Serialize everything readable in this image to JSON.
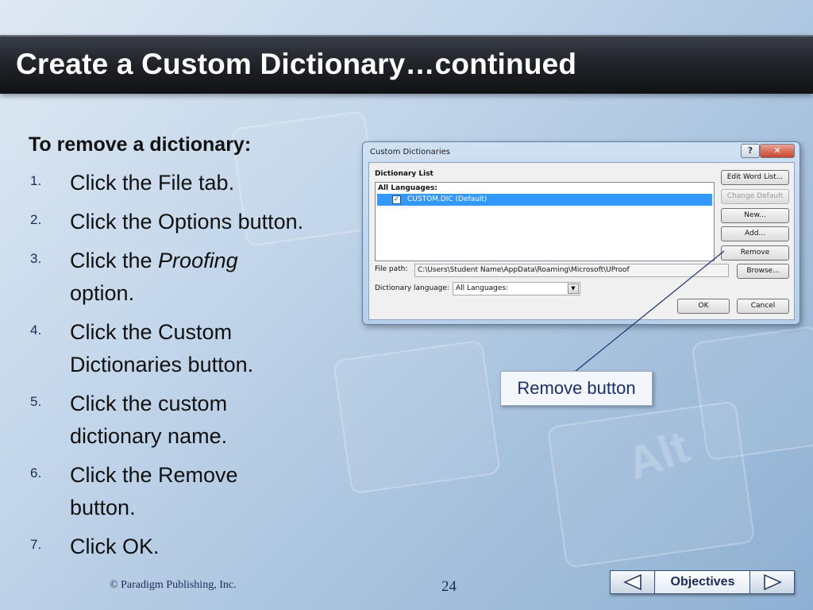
{
  "slide": {
    "title": "Create a Custom Dictionary…continued",
    "steps_heading": "To remove a dictionary:",
    "steps": [
      {
        "num": "1.",
        "text": "Click the File tab."
      },
      {
        "num": "2.",
        "text": "Click the Options button."
      },
      {
        "num": "3.",
        "text_before": "Click the ",
        "text_em": "Proofing",
        "text_after": " option."
      },
      {
        "num": "4.",
        "text": "Click the Custom Dictionaries button."
      },
      {
        "num": "5.",
        "text": "Click the custom dictionary name."
      },
      {
        "num": "6.",
        "text": "Click the Remove button."
      },
      {
        "num": "7.",
        "text": "Click OK."
      }
    ],
    "callout_label": "Remove button",
    "copyright": "© Paradigm Publishing, Inc.",
    "page_number": "24",
    "nav": {
      "objectives_label": "Objectives"
    }
  },
  "dialog": {
    "title": "Custom Dictionaries",
    "help_label": "?",
    "close_label": "✕",
    "dictionary_list_label": "Dictionary List",
    "list_heading": "All Languages:",
    "list_item": "CUSTOM.DIC (Default)",
    "list_item_checked": true,
    "buttons": {
      "edit_word_list": "Edit Word List...",
      "change_default": "Change Default",
      "new": "New...",
      "add": "Add...",
      "remove": "Remove",
      "browse": "Browse...",
      "ok": "OK",
      "cancel": "Cancel"
    },
    "file_path_label": "File path:",
    "file_path_value": "C:\\Users\\Student Name\\AppData\\Roaming\\Microsoft\\UProof",
    "language_label": "Dictionary language:",
    "language_value": "All Languages:"
  },
  "colors": {
    "title_bar": "#1f2227",
    "list_selection": "#3399ff",
    "callout_text": "#1c2f6e"
  }
}
